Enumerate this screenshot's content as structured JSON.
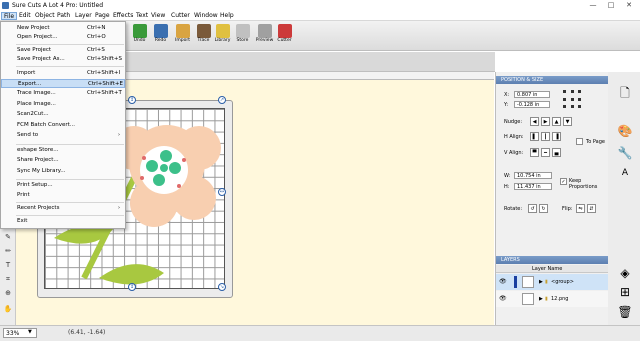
{
  "title": "Sure Cuts A Lot 4 Pro: Untitled",
  "window_buttons": [
    "—",
    "□",
    "✕"
  ],
  "menubar": [
    "File",
    "Edit",
    "Object",
    "Path",
    "Layer",
    "Page",
    "Effects",
    "Text",
    "View",
    "Cutter",
    "Window",
    "Help"
  ],
  "toolbar": [
    "Undo",
    "Redo",
    "Import",
    "Trace",
    "Library",
    "Store",
    "Preview",
    "Cutter"
  ],
  "file_menu": [
    {
      "label": "New Project",
      "shortcut": "Ctrl+N"
    },
    {
      "label": "Open Project...",
      "shortcut": "Ctrl+O"
    },
    {
      "label": "Save Project",
      "shortcut": "Ctrl+S"
    },
    {
      "label": "Save Project As...",
      "shortcut": "Ctrl+Shift+S"
    },
    {
      "label": "Import",
      "shortcut": "Ctrl+Shift+I"
    },
    {
      "label": "Export...",
      "shortcut": "Ctrl+Shift+E"
    },
    {
      "label": "Trace Image...",
      "shortcut": "Ctrl+Shift+T"
    },
    {
      "label": "Place Image...",
      "shortcut": ""
    },
    {
      "label": "Scan2Cut...",
      "shortcut": ""
    },
    {
      "label": "FCM Batch Convert...",
      "shortcut": ""
    },
    {
      "label": "Send to",
      "shortcut": ""
    },
    {
      "label": "eshape Store...",
      "shortcut": ""
    },
    {
      "label": "Share Project...",
      "shortcut": ""
    },
    {
      "label": "Sync My Library...",
      "shortcut": ""
    },
    {
      "label": "Print Setup...",
      "shortcut": ""
    },
    {
      "label": "Print",
      "shortcut": ""
    },
    {
      "label": "Recent Projects",
      "shortcut": ""
    },
    {
      "label": "Exit",
      "shortcut": ""
    }
  ],
  "position_panel": {
    "header": "POSITION & SIZE",
    "x_label": "X:",
    "x_value": "0.807 in",
    "y_label": "Y:",
    "y_value": "-0.128 in",
    "nudge_label": "Nudge:",
    "halign_label": "H Align:",
    "valign_label": "V Align:",
    "to_page_label": "To Page",
    "w_label": "W:",
    "w_value": "10.754 in",
    "h_label": "H:",
    "h_value": "11.437 in",
    "keep_proportions_label": "Keep Proportions",
    "rotate_label": "Rotate:",
    "flip_label": "Flip:"
  },
  "layers_panel": {
    "header": "LAYERS",
    "column_header": "Layer Name",
    "rows": [
      "<group>",
      "12.png"
    ]
  },
  "status": {
    "zoom": "33%",
    "coords": "(6.41, -1.64)"
  },
  "accent": "#2b5fa8",
  "highlight_color": "#c8def5"
}
